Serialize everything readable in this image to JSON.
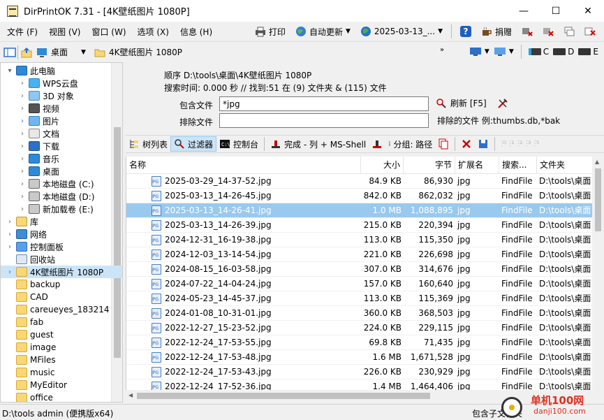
{
  "window": {
    "title": "DirPrintOK 7.31 - [4K壁纸图片 1080P]",
    "min": "—",
    "max": "☐",
    "close": "✕"
  },
  "menu": {
    "items": [
      "文件 (F)",
      "视图 (V)",
      "窗口 (W)",
      "选项 (X)",
      "信息 (H)"
    ],
    "print": "打印",
    "auto_update": "自动更新",
    "date": "2025-03-13_...",
    "help": "?",
    "donate": "捐赠"
  },
  "address": {
    "desktop": "桌面",
    "folder": "4K壁纸图片 1080P",
    "drives": [
      "C",
      "D",
      "E"
    ]
  },
  "tree": [
    {
      "label": "此电脑",
      "arrow": "▾",
      "indent": 0,
      "icon": "pc"
    },
    {
      "label": "WPS云盘",
      "arrow": "›",
      "indent": 1,
      "icon": "cloud"
    },
    {
      "label": "3D 对象",
      "arrow": "›",
      "indent": 1,
      "icon": "cube"
    },
    {
      "label": "视频",
      "arrow": "›",
      "indent": 1,
      "icon": "video"
    },
    {
      "label": "图片",
      "arrow": "›",
      "indent": 1,
      "icon": "picture"
    },
    {
      "label": "文档",
      "arrow": "›",
      "indent": 1,
      "icon": "document"
    },
    {
      "label": "下载",
      "arrow": "›",
      "indent": 1,
      "icon": "download"
    },
    {
      "label": "音乐",
      "arrow": "›",
      "indent": 1,
      "icon": "music"
    },
    {
      "label": "桌面",
      "arrow": "›",
      "indent": 1,
      "icon": "desktop"
    },
    {
      "label": "本地磁盘 (C:)",
      "arrow": "›",
      "indent": 1,
      "icon": "drive"
    },
    {
      "label": "本地磁盘 (D:)",
      "arrow": "›",
      "indent": 1,
      "icon": "drive"
    },
    {
      "label": "新加载卷 (E:)",
      "arrow": "›",
      "indent": 1,
      "icon": "drive"
    },
    {
      "label": "库",
      "arrow": "›",
      "indent": 0,
      "icon": "library"
    },
    {
      "label": "网络",
      "arrow": "›",
      "indent": 0,
      "icon": "network"
    },
    {
      "label": "控制面板",
      "arrow": "›",
      "indent": 0,
      "icon": "control-panel"
    },
    {
      "label": "回收站",
      "arrow": "",
      "indent": 0,
      "icon": "recycle-bin"
    },
    {
      "label": "4K壁纸图片 1080P",
      "arrow": "›",
      "indent": 0,
      "icon": "folder",
      "selected": true
    },
    {
      "label": "backup",
      "arrow": "",
      "indent": 0,
      "icon": "folder"
    },
    {
      "label": "CAD",
      "arrow": "",
      "indent": 0,
      "icon": "folder"
    },
    {
      "label": "careueyes_183214",
      "arrow": "",
      "indent": 0,
      "icon": "folder"
    },
    {
      "label": "fab",
      "arrow": "",
      "indent": 0,
      "icon": "folder"
    },
    {
      "label": "guest",
      "arrow": "",
      "indent": 0,
      "icon": "folder"
    },
    {
      "label": "image",
      "arrow": "",
      "indent": 0,
      "icon": "folder"
    },
    {
      "label": "MFiles",
      "arrow": "",
      "indent": 0,
      "icon": "folder"
    },
    {
      "label": "music",
      "arrow": "",
      "indent": 0,
      "icon": "folder"
    },
    {
      "label": "MyEditor",
      "arrow": "",
      "indent": 0,
      "icon": "folder"
    },
    {
      "label": "office",
      "arrow": "",
      "indent": 0,
      "icon": "folder"
    }
  ],
  "info": {
    "order_line": "顺序   D:\\tools\\桌面\\4K壁纸图片 1080P",
    "search_line": "搜索时间: 0.000 秒 //  找到:51 在 (9) 文件夹 & (115) 文件",
    "include_label": "包含文件",
    "include_value": "*jpg",
    "exclude_label": "排除文件",
    "exclude_value": "",
    "refresh": "刷新 [F5]",
    "exclude_note": "排除的文件 例:thumbs.db,*bak"
  },
  "toolbar3": {
    "tree_list": "树列表",
    "filter": "过滤器",
    "console": "控制台",
    "complete": "完成 - 列 + MS-Shell",
    "group": "分组: 路径"
  },
  "table": {
    "headers": [
      "名称",
      "大小",
      "字节",
      "扩展名",
      "搜索...",
      "文件夹"
    ],
    "rows": [
      [
        "2025-03-29_14-37-52.jpg",
        "84.9 KB",
        "86,930",
        "jpg",
        "FindFile",
        "D:\\tools\\桌面"
      ],
      [
        "2025-03-13_14-26-45.jpg",
        "842.0 KB",
        "862,032",
        "jpg",
        "FindFile",
        "D:\\tools\\桌面"
      ],
      [
        "2025-03-13_14-26-41.jpg",
        "1.0 MB",
        "1,088,895",
        "jpg",
        "FindFile",
        "D:\\tools\\桌面"
      ],
      [
        "2025-03-13_14-26-39.jpg",
        "215.0 KB",
        "220,394",
        "jpg",
        "FindFile",
        "D:\\tools\\桌面"
      ],
      [
        "2024-12-31_16-19-38.jpg",
        "113.0 KB",
        "115,350",
        "jpg",
        "FindFile",
        "D:\\tools\\桌面"
      ],
      [
        "2024-12-03_13-14-54.jpg",
        "221.0 KB",
        "226,698",
        "jpg",
        "FindFile",
        "D:\\tools\\桌面"
      ],
      [
        "2024-08-15_16-03-58.jpg",
        "307.0 KB",
        "314,676",
        "jpg",
        "FindFile",
        "D:\\tools\\桌面"
      ],
      [
        "2024-07-22_14-04-24.jpg",
        "157.0 KB",
        "160,640",
        "jpg",
        "FindFile",
        "D:\\tools\\桌面"
      ],
      [
        "2024-05-23_14-45-37.jpg",
        "113.0 KB",
        "115,369",
        "jpg",
        "FindFile",
        "D:\\tools\\桌面"
      ],
      [
        "2024-01-08_10-31-01.jpg",
        "360.0 KB",
        "368,503",
        "jpg",
        "FindFile",
        "D:\\tools\\桌面"
      ],
      [
        "2022-12-27_15-23-52.jpg",
        "224.0 KB",
        "229,115",
        "jpg",
        "FindFile",
        "D:\\tools\\桌面"
      ],
      [
        "2022-12-24_17-53-55.jpg",
        "69.8 KB",
        "71,435",
        "jpg",
        "FindFile",
        "D:\\tools\\桌面"
      ],
      [
        "2022-12-24_17-53-48.jpg",
        "1.6 MB",
        "1,671,528",
        "jpg",
        "FindFile",
        "D:\\tools\\桌面"
      ],
      [
        "2022-12-24_17-53-43.jpg",
        "226.0 KB",
        "230,929",
        "jpg",
        "FindFile",
        "D:\\tools\\桌面"
      ],
      [
        "2022-12-24_17-52-36.jpg",
        "1.4 MB",
        "1,464,406",
        "jpg",
        "FindFile",
        "D:\\tools\\桌面"
      ]
    ],
    "selected_index": 2
  },
  "status": {
    "left": "D:\\tools  admin (便携版x64)",
    "right": "包含子文件夹"
  },
  "watermark": {
    "name": "单机100网",
    "url": "danji100.com"
  }
}
